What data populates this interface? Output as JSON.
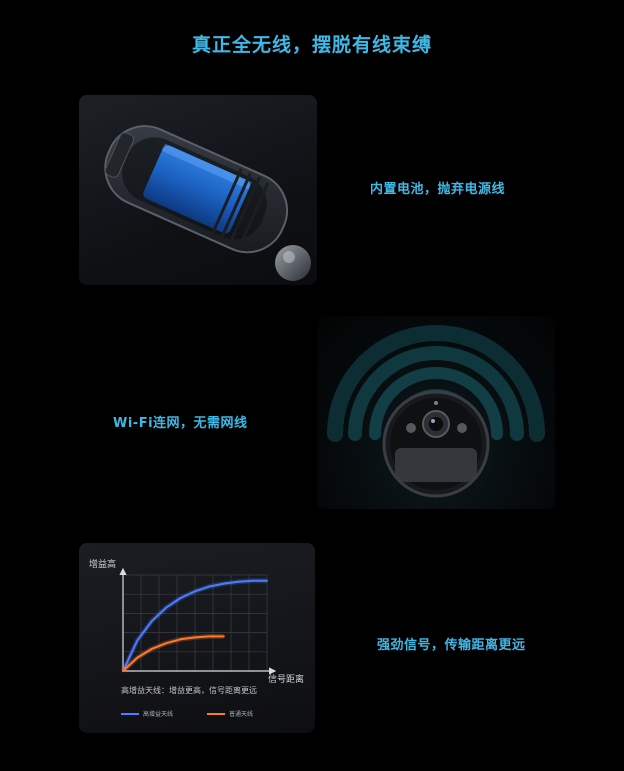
{
  "title": "真正全无线，摆脱有线束缚",
  "features": [
    {
      "caption": "内置电池，抛弃电源线",
      "icon": "battery-camera-cutaway-illustration"
    },
    {
      "caption": "Wi-Fi连网，无需网线",
      "icon": "camera-wifi-signal-illustration"
    },
    {
      "caption": "强劲信号，传输距离更远",
      "icon": "antenna-gain-chart"
    }
  ],
  "colors": {
    "accent": "#3fb8e6",
    "high_gain": "#4a7dff",
    "ordinary": "#ff7a2a",
    "background": "#000000"
  },
  "chart_data": {
    "type": "line",
    "ylabel": "增益高",
    "xlabel": "信号距离",
    "annotation": "高增益天线：增益更高，信号距离更远",
    "grid": true,
    "legend_position": "bottom",
    "xlim": [
      0,
      1
    ],
    "ylim": [
      0,
      1
    ],
    "series": [
      {
        "name": "高增益天线",
        "color": "#4a7dff",
        "x": [
          0,
          0.1,
          0.2,
          0.3,
          0.4,
          0.5,
          0.6,
          0.7,
          0.8,
          0.9,
          1.0
        ],
        "y": [
          0,
          0.32,
          0.52,
          0.66,
          0.76,
          0.83,
          0.88,
          0.91,
          0.93,
          0.94,
          0.94
        ]
      },
      {
        "name": "普通天线",
        "color": "#ff7a2a",
        "x": [
          0,
          0.1,
          0.2,
          0.3,
          0.4,
          0.5,
          0.6,
          0.7
        ],
        "y": [
          0,
          0.14,
          0.23,
          0.29,
          0.33,
          0.35,
          0.36,
          0.36
        ]
      }
    ]
  }
}
